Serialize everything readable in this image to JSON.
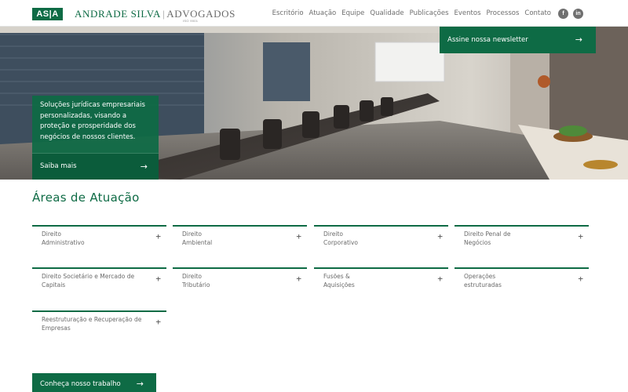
{
  "header": {
    "logo_mark": "AS|A",
    "logo_name": "Andrade Silva",
    "logo_sep": "|",
    "logo_suffix": "Advogados",
    "logo_iso": "ISO 9001",
    "nav": [
      "Escritório",
      "Atuação",
      "Equipe",
      "Qualidade",
      "Publicações",
      "Eventos",
      "Processos",
      "Contato"
    ],
    "social": {
      "facebook": "f",
      "linkedin": "in"
    }
  },
  "hero": {
    "newsletter_label": "Assine nossa newsletter",
    "card_text": "Soluções jurídicas empresariais personalizadas, visando a proteção e prosperidade dos negócios de nossos clientes.",
    "card_link": "Saiba mais",
    "arrow": "→"
  },
  "areas": {
    "title": "Áreas de Atuação",
    "plus": "+",
    "items": [
      "Direito Administrativo",
      "Direito Ambiental",
      "Direito Corporativo",
      "Direito Penal de Negócios",
      "Direito Societário e Mercado de Capitais",
      "Direito Tributário",
      "Fusões & Aquisições",
      "Operações estruturadas",
      "Reestruturação e Recuperação de Empresas"
    ]
  },
  "cta": {
    "label": "Conheça nosso trabalho",
    "arrow": "→"
  },
  "colors": {
    "brand": "#0e6b45",
    "text": "#6e6e6e"
  }
}
